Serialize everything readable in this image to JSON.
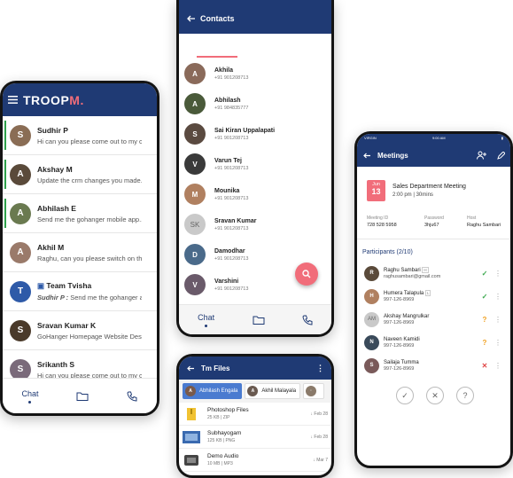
{
  "chat_screen": {
    "logo_text": "TROOP",
    "logo_accent": "M.",
    "chats": [
      {
        "name": "Sudhir P",
        "message": "Hi can you please come out to my c...",
        "unread": true
      },
      {
        "name": "Akshay M",
        "message": "Update the crm changes you made...",
        "unread": true
      },
      {
        "name": "Abhilash E",
        "message": "Send me the gohanger mobile app...",
        "unread": true
      },
      {
        "name": "Akhil M",
        "message": "Raghu, can you please switch on th...",
        "unread": false
      },
      {
        "name": "Team Tvisha",
        "sender": "Sudhir P :",
        "message": "Send me the gohanger app...",
        "unread": false
      },
      {
        "name": "Sravan Kumar K",
        "message": "GoHanger Homepage Website Desi...",
        "unread": false
      },
      {
        "name": "Srikanth S",
        "message": "Hi can you please come out to my c...",
        "unread": false
      }
    ],
    "tabs": {
      "chat": "Chat"
    }
  },
  "contacts_screen": {
    "title": "Contacts",
    "tabs": {
      "chat": "Chat"
    },
    "contacts": [
      {
        "name": "Akhila",
        "phone": "+91 901208713"
      },
      {
        "name": "Abhilash",
        "phone": "+91 984835777"
      },
      {
        "name": "Sai Kiran Uppalapati",
        "phone": "+91 901208713"
      },
      {
        "name": "Varun Tej",
        "phone": "+91 901208713"
      },
      {
        "name": "Mounika",
        "phone": "+91 901208713"
      },
      {
        "name": "Sravan Kumar",
        "phone": "+91 901208713",
        "initials": "SK"
      },
      {
        "name": "Damodhar",
        "phone": "+91 901208713"
      },
      {
        "name": "Varshini",
        "phone": "+91 901208713"
      }
    ]
  },
  "files_screen": {
    "title": "Tm Files",
    "chips": [
      "Abhilash Engala",
      "Akhil Malayala"
    ],
    "files": [
      {
        "name": "Photoshop Files",
        "size": "25 KB",
        "type": "ZIP",
        "date": "Feb 28"
      },
      {
        "name": "Subhayogam",
        "size": "125 KB",
        "type": "PNG",
        "date": "Feb 28"
      },
      {
        "name": "Demo Audio",
        "size": "10 MB",
        "type": "MP3",
        "date": "Mar 7"
      }
    ]
  },
  "meeting_screen": {
    "status": {
      "carrier": "VIRGIN",
      "time": "9:00 AM"
    },
    "title": "Meetings",
    "month": "Jun",
    "day": "13",
    "meeting_title": "Sales Department Meeting",
    "time": "2:00 pm",
    "duration": "30mins",
    "meeting_id_label": "Meeting ID",
    "meeting_id": "728 528 5958",
    "password_label": "Password",
    "password": "3hju67",
    "host_label": "Host",
    "host": "Raghu Sambari",
    "participants_heading": "Participants (2/10)",
    "participants": [
      {
        "name": "Raghu Sambari",
        "badge": "H",
        "email": "raghusambari@gmail.com",
        "status": "✓",
        "status_color": "#3aa84d"
      },
      {
        "name": "Humera Talapula",
        "badge": "L",
        "phone": "997-126-8969",
        "status": "✓",
        "status_color": "#3aa84d"
      },
      {
        "name": "Akshay Mangrulkar",
        "phone": "997-126-8969",
        "initials": "AM",
        "status": "?",
        "status_color": "#f0a020"
      },
      {
        "name": "Naveen Kamidi",
        "phone": "997-126-8969",
        "status": "?",
        "status_color": "#f0a020"
      },
      {
        "name": "Sailaja Tumma",
        "phone": "997-126-8969",
        "status": "✕",
        "status_color": "#e04848"
      }
    ]
  },
  "colors": {
    "navy": "#1f3a74",
    "accent": "#f16d7a"
  }
}
